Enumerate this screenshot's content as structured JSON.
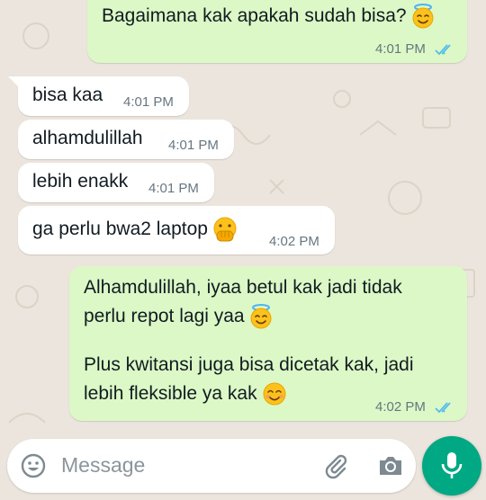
{
  "colors": {
    "wallpaper": "#ece5dd",
    "incoming_bubble": "#ffffff",
    "outgoing_bubble": "#dcf8c6",
    "read_ticks": "#53bdeb",
    "mic_button": "#00a884"
  },
  "messages": [
    {
      "direction": "out",
      "text": "Bagaimana kak apakah sudah bisa?",
      "emoji": "smiling-face-with-halo",
      "time": "4:01 PM",
      "status": "read"
    },
    {
      "direction": "in",
      "text": "bisa kaa",
      "time": "4:01 PM"
    },
    {
      "direction": "in",
      "text": "alhamdulillah",
      "time": "4:01 PM"
    },
    {
      "direction": "in",
      "text": "lebih enakk",
      "time": "4:01 PM"
    },
    {
      "direction": "in",
      "text": "ga perlu bwa2 laptop",
      "emoji": "face-with-hand-over-mouth",
      "time": "4:02 PM"
    },
    {
      "direction": "out",
      "lines": [
        "Alhamdulillah, iyaa betul kak jadi tidak",
        "perlu repot lagi yaa",
        "Plus kwitansi juga bisa dicetak kak, jadi",
        "lebih fleksible ya kak"
      ],
      "emojis": [
        "smiling-face-with-halo",
        "smiling-face-with-smiling-eyes"
      ],
      "time": "4:02 PM",
      "status": "read"
    }
  ],
  "input_bar": {
    "placeholder": "Message",
    "icons": [
      "emoji-icon",
      "attach-icon",
      "camera-icon",
      "mic-icon"
    ]
  }
}
